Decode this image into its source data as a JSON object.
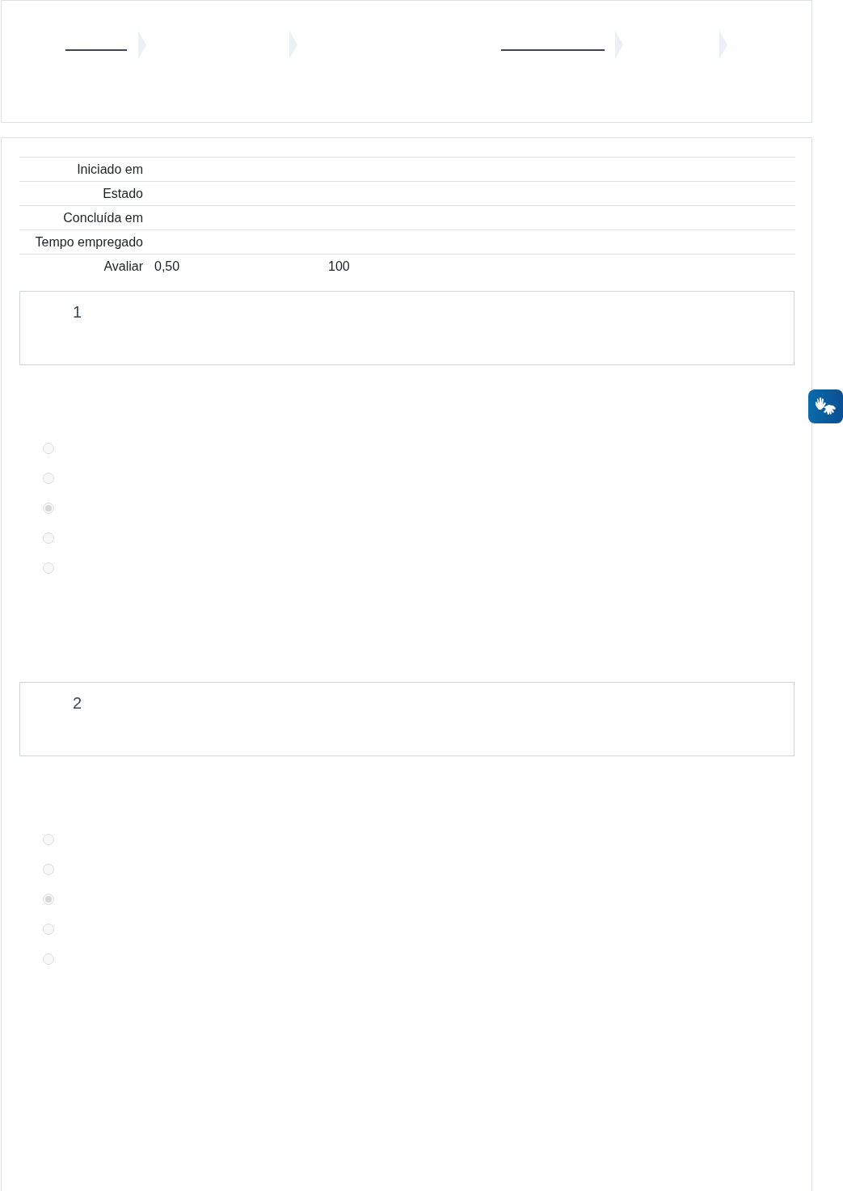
{
  "summary": {
    "rows": [
      {
        "label": "Iniciado em"
      },
      {
        "label": "Estado"
      },
      {
        "label": "Concluída em"
      },
      {
        "label": "Tempo empregado"
      },
      {
        "label": "Avaliar",
        "value": "0,50",
        "column_3": "100"
      }
    ]
  },
  "questions": [
    {
      "number": "1",
      "options": [
        {
          "selected": false
        },
        {
          "selected": false
        },
        {
          "selected": true
        },
        {
          "selected": false
        },
        {
          "selected": false
        }
      ]
    },
    {
      "number": "2",
      "options": [
        {
          "selected": false
        },
        {
          "selected": false
        },
        {
          "selected": true
        },
        {
          "selected": false
        },
        {
          "selected": false
        }
      ]
    }
  ]
}
